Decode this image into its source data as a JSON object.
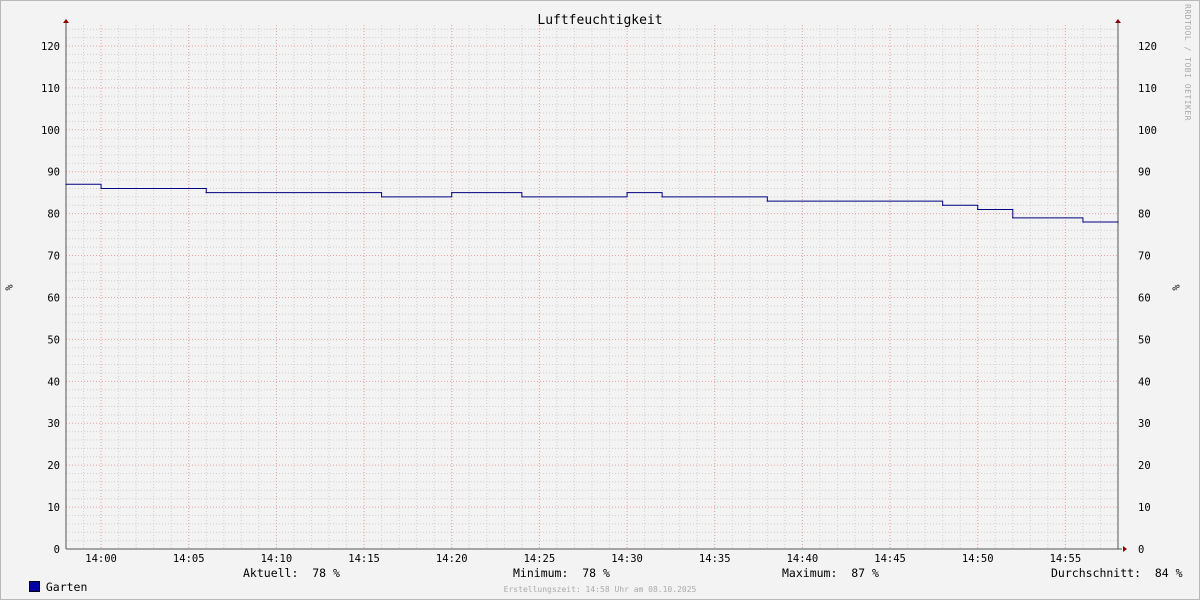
{
  "chart_data": {
    "type": "line",
    "title": "Luftfeuchtigkeit",
    "ylabel": "%",
    "ylim": [
      0,
      125
    ],
    "y_ticks": [
      0,
      10,
      20,
      30,
      40,
      50,
      60,
      70,
      80,
      90,
      100,
      110,
      120
    ],
    "x_range": [
      "13:58",
      "14:58"
    ],
    "x_ticks": [
      "14:00",
      "14:05",
      "14:10",
      "14:15",
      "14:20",
      "14:25",
      "14:30",
      "14:35",
      "14:40",
      "14:45",
      "14:50",
      "14:55"
    ],
    "grid": true,
    "series": [
      {
        "name": "Garten",
        "color": "#000080",
        "step": true,
        "points": [
          {
            "x": "13:58",
            "y": 87
          },
          {
            "x": "14:00",
            "y": 86
          },
          {
            "x": "14:06",
            "y": 85
          },
          {
            "x": "14:16",
            "y": 84
          },
          {
            "x": "14:20",
            "y": 85
          },
          {
            "x": "14:24",
            "y": 84
          },
          {
            "x": "14:30",
            "y": 85
          },
          {
            "x": "14:32",
            "y": 84
          },
          {
            "x": "14:38",
            "y": 83
          },
          {
            "x": "14:48",
            "y": 82
          },
          {
            "x": "14:50",
            "y": 81
          },
          {
            "x": "14:52",
            "y": 79
          },
          {
            "x": "14:56",
            "y": 78
          },
          {
            "x": "14:58",
            "y": 78
          }
        ]
      }
    ]
  },
  "legend": {
    "series_name": "Garten",
    "swatch_color": "#0000aa",
    "current": "Aktuell:  78 %",
    "minimum": "Minimum:  78 %",
    "maximum": "Maximum:  87 %",
    "average": "Durchschnitt:  84 %"
  },
  "footer": "Erstellungszeit: 14:58 Uhr am 08.10.2025",
  "watermark": "RRDTOOL / TOBI OETIKER",
  "colors": {
    "major_grid": "#e8a0a0",
    "minor_grid": "#d0d0d0",
    "axis": "#555555",
    "arrow": "#8b0000",
    "line": "#000080"
  }
}
